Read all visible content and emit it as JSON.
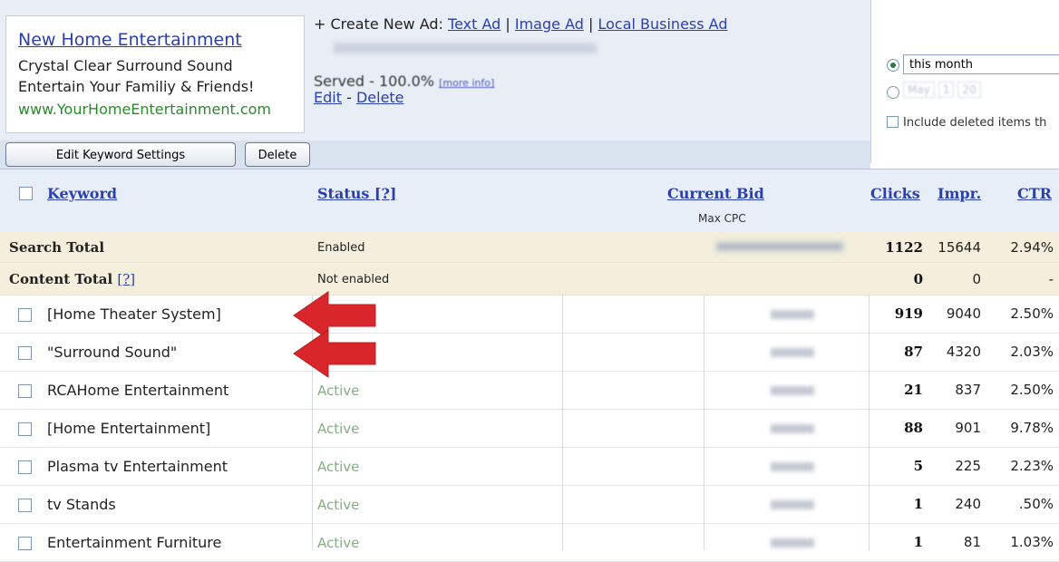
{
  "ad": {
    "title": "New Home Entertainment",
    "line1": "Crystal Clear Surround Sound",
    "line2": "Entertain Your Familiy & Friends!",
    "url": "www.YourHomeEntertainment.com"
  },
  "create": {
    "prefix": "+ Create New Ad:",
    "text_ad": "Text Ad",
    "image_ad": "Image Ad",
    "local_ad": "Local Business Ad",
    "sep": "|"
  },
  "served": {
    "label": "Served - 100.0%",
    "more_info": "[more info]",
    "edit": "Edit",
    "dash": "-",
    "delete": "Delete"
  },
  "date_panel": {
    "range_value": "this month",
    "month": "May",
    "day": "1",
    "year": "20",
    "include_label": "Include deleted items th"
  },
  "toolbar": {
    "edit_keyword_settings": "Edit Keyword Settings",
    "delete": "Delete"
  },
  "table": {
    "headers": {
      "keyword": "Keyword",
      "status": "Status [?]",
      "current_bid": "Current Bid",
      "max_cpc": "Max CPC",
      "clicks": "Clicks",
      "impr": "Impr.",
      "ctr": "CTR"
    },
    "search_total": {
      "label": "Search Total",
      "status": "Enabled",
      "clicks": "1122",
      "impr": "15644",
      "ctr": "2.94%"
    },
    "content_total": {
      "label": "Content Total",
      "help": "[?]",
      "status": "Not enabled",
      "clicks": "0",
      "impr": "0",
      "ctr": "-"
    },
    "rows": [
      {
        "keyword": "[Home Theater System]",
        "status": "",
        "clicks": "919",
        "impr": "9040",
        "ctr": "2.50%"
      },
      {
        "keyword": "\"Surround Sound\"",
        "status": "",
        "clicks": "87",
        "impr": "4320",
        "ctr": "2.03%"
      },
      {
        "keyword": "RCAHome Entertainment",
        "status": "Active",
        "clicks": "21",
        "impr": "837",
        "ctr": "2.50%"
      },
      {
        "keyword": "[Home Entertainment]",
        "status": "Active",
        "clicks": "88",
        "impr": "901",
        "ctr": "9.78%"
      },
      {
        "keyword": "Plasma tv Entertainment",
        "status": "Active",
        "clicks": "5",
        "impr": "225",
        "ctr": "2.23%"
      },
      {
        "keyword": "tv Stands",
        "status": "Active",
        "clicks": "1",
        "impr": "240",
        "ctr": ".50%"
      },
      {
        "keyword": "Entertainment Furniture",
        "status": "Active",
        "clicks": "1",
        "impr": "81",
        "ctr": "1.03%"
      }
    ]
  },
  "colors": {
    "link": "#2a3fb0",
    "active_status": "#84b084",
    "total_row_bg": "#f3efdc",
    "header_bg": "#e8eef7",
    "arrow_red": "#d8262b"
  }
}
